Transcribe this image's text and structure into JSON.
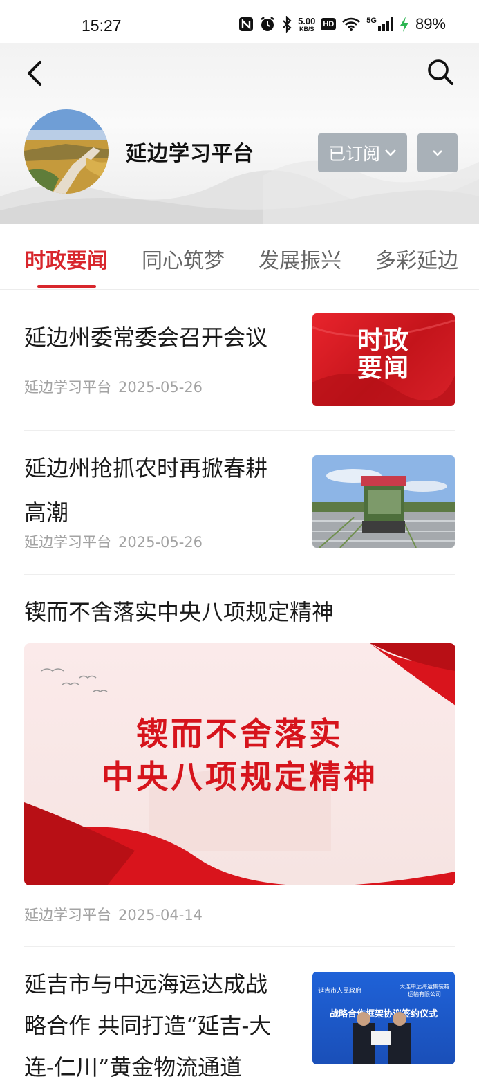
{
  "status_bar": {
    "time": "15:27",
    "network_speed_value": "5.00",
    "network_speed_unit": "KB/S",
    "hd_label": "HD",
    "network_type": "5G",
    "battery": "89%",
    "icons": [
      "nfc-icon",
      "alarm-icon",
      "bluetooth-icon",
      "hd-icon",
      "wifi-icon",
      "signal-icon",
      "charging-icon"
    ]
  },
  "header": {
    "channel_name": "延边学习平台",
    "subscribe_label": "已订阅",
    "icons": [
      "back-arrow-icon",
      "search-icon",
      "chevron-down-icon"
    ]
  },
  "tabs": [
    "时政要闻",
    "同心筑梦",
    "发展振兴",
    "多彩延边"
  ],
  "active_tab": 0,
  "articles": [
    {
      "title": "延边州委常委会召开会议",
      "source": "延边学习平台",
      "date": "2025-05-26",
      "thumb_text": [
        "时政",
        "要闻"
      ]
    },
    {
      "title_lines": [
        "延边州抢抓农时再掀春耕",
        "高潮"
      ],
      "source": "延边学习平台",
      "date": "2025-05-26"
    },
    {
      "title": "锲而不舍落实中央八项规定精神",
      "source": "延边学习平台",
      "date": "2025-04-14",
      "banner_lines": [
        "锲而不舍落实",
        "中央八项规定精神"
      ]
    },
    {
      "title_lines": [
        "延吉市与中远海运达成战",
        "略合作 共同打造“延吉-大",
        "连-仁川”黄金物流通道"
      ],
      "thumb_left": "延吉市人民政府",
      "thumb_right_lines": [
        "大连中远海运集装箱",
        "运输有限公司"
      ],
      "thumb_center": "战略合作框架协议签约仪式"
    }
  ],
  "colors": {
    "accent": "#d8262c",
    "button_gray": "#a9b1b8",
    "meta_gray": "#a3a3a3"
  }
}
